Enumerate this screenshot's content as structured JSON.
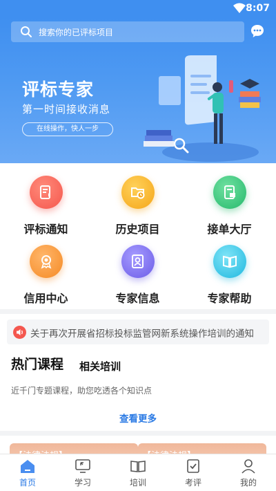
{
  "status_bar": {
    "time": "8:07"
  },
  "search": {
    "placeholder": "搜索你的已评标项目"
  },
  "banner": {
    "title": "评标专家",
    "subtitle": "第一时间接收消息",
    "button": "在线操作，快人一步"
  },
  "grid": [
    {
      "label": "评标通知",
      "icon": "notice-doc-icon",
      "color": "#f5645a"
    },
    {
      "label": "历史项目",
      "icon": "folder-clock-icon",
      "color": "#f7b21f"
    },
    {
      "label": "接单大厅",
      "icon": "order-hall-icon",
      "color": "#35c37b"
    },
    {
      "label": "信用中心",
      "icon": "medal-icon",
      "color": "#f99a3a"
    },
    {
      "label": "专家信息",
      "icon": "expert-card-icon",
      "color": "#7b6cf0"
    },
    {
      "label": "专家帮助",
      "icon": "help-book-icon",
      "color": "#39c3e6"
    }
  ],
  "notice": {
    "text": "关于再次开展省招标投标监管网新系统操作培训的通知"
  },
  "courses": {
    "title": "热门课程",
    "tab": "相关培训",
    "desc": "近千门专题课程，助您吃透各个知识点",
    "see_more": "查看更多",
    "cards": [
      {
        "tag": "【法律法规】"
      },
      {
        "tag": "【法律法规】"
      }
    ]
  },
  "tabbar": [
    {
      "label": "首页",
      "icon": "home-icon",
      "active": true
    },
    {
      "label": "学习",
      "icon": "study-icon",
      "active": false
    },
    {
      "label": "培训",
      "icon": "book-icon",
      "active": false
    },
    {
      "label": "考评",
      "icon": "exam-check-icon",
      "active": false
    },
    {
      "label": "我的",
      "icon": "user-icon",
      "active": false
    }
  ],
  "colors": {
    "primary": "#3f8ff0",
    "link": "#2c7be5"
  }
}
